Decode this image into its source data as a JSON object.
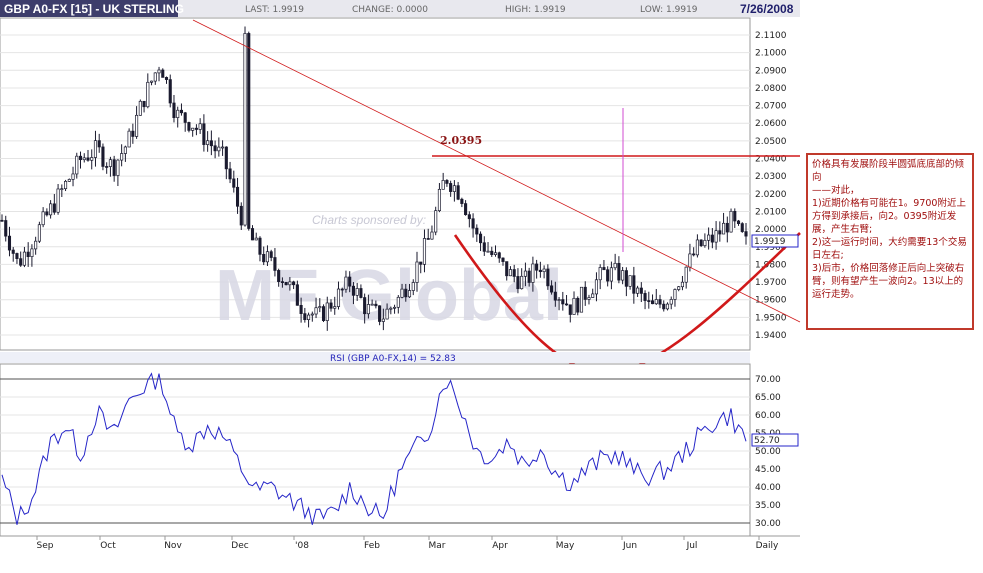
{
  "header": {
    "title": "GBP A0-FX [15] - UK STERLING",
    "last": "LAST: 1.9919",
    "change": "CHANGE: 0.0000",
    "high": "HIGH: 1.9919",
    "low": "LOW: 1.9919",
    "date": "7/26/2008"
  },
  "watermark": {
    "sponsor_text": "Charts sponsored by:",
    "logo_text": "MF Global"
  },
  "annotation": {
    "level_label": "2.0395",
    "lines": [
      "价格具有发展阶段半圆弧底底部的倾向",
      "——对此，",
      "1)近期价格有可能在1。9700附近上方得到承接后，向2。0395附近发展，产生右臂;",
      "2)这一运行时间，大约需要13个交易日左右;",
      "3)后市，价格回落修正后向上突破右臂，则有望产生一波向2。13以上的运行走势。"
    ]
  },
  "colors": {
    "price": "#1a1a2e",
    "rsi": "#2525c8",
    "annotation": "#d0191a",
    "header_bg": "#3d3d6b",
    "magenta": "#d24bd2"
  },
  "chart_data": [
    {
      "type": "candlestick",
      "title": "GBP A0-FX [15] - UK STERLING",
      "ylim": [
        1.93,
        2.12
      ],
      "y_ticks": [
        "2.1100",
        "2.1000",
        "2.0900",
        "2.0800",
        "2.0700",
        "2.0600",
        "2.0500",
        "2.0400",
        "2.0300",
        "2.0200",
        "2.0100",
        "2.0000",
        "1.9900",
        "1.9800",
        "1.9700",
        "1.9600",
        "1.9500",
        "1.9400"
      ],
      "x_labels": [
        "Sep",
        "Oct",
        "Nov",
        "Dec",
        "'08",
        "Feb",
        "Mar",
        "Apr",
        "May",
        "Jun",
        "Jul",
        "Daily"
      ],
      "last_value": "1.9919",
      "series": [
        {
          "name": "GBP A0-FX",
          "x": [
            "2007-08-27",
            "2007-09-03",
            "2007-09-10",
            "2007-09-17",
            "2007-09-24",
            "2007-10-01",
            "2007-10-08",
            "2007-10-15",
            "2007-10-22",
            "2007-10-29",
            "2007-11-05",
            "2007-11-12",
            "2007-11-19",
            "2007-11-26",
            "2007-12-03",
            "2007-12-10",
            "2007-12-17",
            "2007-12-24",
            "2007-12-31",
            "2008-01-07",
            "2008-01-14",
            "2008-01-21",
            "2008-01-28",
            "2008-02-04",
            "2008-02-11",
            "2008-02-18",
            "2008-02-25",
            "2008-03-03",
            "2008-03-10",
            "2008-03-17",
            "2008-03-24",
            "2008-03-31",
            "2008-04-07",
            "2008-04-14",
            "2008-04-21",
            "2008-04-28",
            "2008-05-05",
            "2008-05-12",
            "2008-05-19",
            "2008-05-26",
            "2008-06-02",
            "2008-06-09",
            "2008-06-16",
            "2008-06-23",
            "2008-06-30",
            "2008-07-07",
            "2008-07-14",
            "2008-07-21"
          ],
          "values": [
            2.005,
            1.98,
            1.995,
            2.01,
            2.025,
            2.04,
            2.045,
            2.035,
            2.05,
            2.075,
            2.095,
            2.065,
            2.06,
            2.05,
            2.04,
            2.01,
            1.99,
            1.98,
            1.97,
            1.955,
            1.95,
            1.96,
            1.97,
            1.955,
            1.95,
            1.96,
            1.975,
            1.995,
            2.03,
            2.02,
            1.995,
            1.985,
            1.975,
            1.97,
            1.98,
            1.965,
            1.955,
            1.965,
            1.975,
            1.975,
            1.965,
            1.955,
            1.96,
            1.975,
            1.99,
            1.995,
            2.005,
            1.9919
          ],
          "markers": {
            "high": 2.113,
            "high_date": "2007-11-08",
            "low": 1.938,
            "low_date": "2008-01-21"
          }
        }
      ],
      "annotations": {
        "horizontal_level": 2.0395,
        "horizontal_label": "2.0395"
      }
    },
    {
      "type": "line",
      "title": "RSI (GBP A0-FX,14) = 52.83",
      "ylim": [
        28,
        72
      ],
      "y_ticks": [
        "70.00",
        "65.00",
        "60.00",
        "55.00",
        "50.00",
        "45.00",
        "40.00",
        "35.00",
        "30.00"
      ],
      "last_value": "52.70",
      "series": [
        {
          "name": "RSI (GBP A0-FX,14)",
          "x": [
            "2007-08-27",
            "2007-09-03",
            "2007-09-10",
            "2007-09-17",
            "2007-09-24",
            "2007-10-01",
            "2007-10-08",
            "2007-10-15",
            "2007-10-22",
            "2007-10-29",
            "2007-11-05",
            "2007-11-12",
            "2007-11-19",
            "2007-11-26",
            "2007-12-03",
            "2007-12-10",
            "2007-12-17",
            "2007-12-24",
            "2007-12-31",
            "2008-01-07",
            "2008-01-14",
            "2008-01-21",
            "2008-01-28",
            "2008-02-04",
            "2008-02-11",
            "2008-02-18",
            "2008-02-25",
            "2008-03-03",
            "2008-03-10",
            "2008-03-17",
            "2008-03-24",
            "2008-03-31",
            "2008-04-07",
            "2008-04-14",
            "2008-04-21",
            "2008-04-28",
            "2008-05-05",
            "2008-05-12",
            "2008-05-19",
            "2008-05-26",
            "2008-06-02",
            "2008-06-09",
            "2008-06-16",
            "2008-06-23",
            "2008-06-30",
            "2008-07-07",
            "2008-07-14",
            "2008-07-21"
          ],
          "values": [
            42,
            31,
            38,
            52,
            57,
            49,
            61,
            54,
            64,
            68,
            71,
            55,
            52,
            57,
            54,
            46,
            39,
            40,
            37,
            34,
            31,
            33,
            40,
            35,
            31,
            43,
            50,
            56,
            71,
            62,
            50,
            48,
            53,
            46,
            51,
            44,
            41,
            45,
            48,
            49,
            44,
            43,
            45,
            49,
            54,
            58,
            60,
            52.7
          ]
        }
      ],
      "reference_lines": [
        70,
        30
      ]
    }
  ]
}
